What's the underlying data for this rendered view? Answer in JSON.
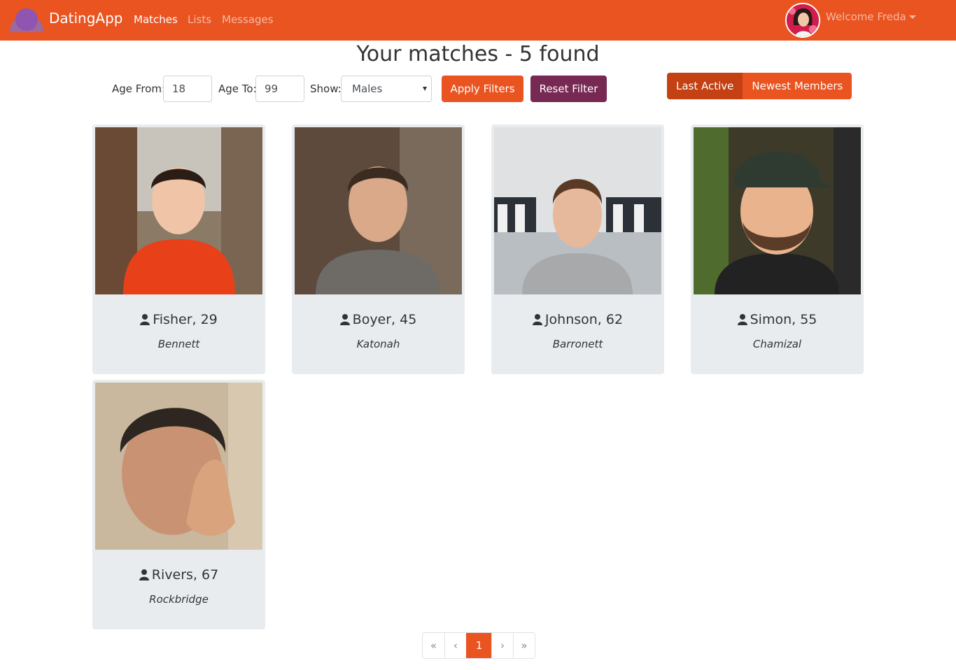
{
  "colors": {
    "primary": "#E95420",
    "secondary": "#772953",
    "card_bg": "#e9ecef"
  },
  "navbar": {
    "brand": "DatingApp",
    "links": [
      "Matches",
      "Lists",
      "Messages"
    ],
    "active_link": "Matches",
    "welcome": "Welcome Freda"
  },
  "page": {
    "title": "Your matches - 5 found"
  },
  "filters": {
    "age_from_label": "Age From:",
    "age_from_value": "18",
    "age_to_label": "Age To:",
    "age_to_value": "99",
    "show_label": "Show:",
    "show_value": "Males",
    "apply_label": "Apply Filters",
    "reset_label": "Reset Filter"
  },
  "sort": {
    "options": [
      "Last Active",
      "Newest Members"
    ],
    "active": "Last Active"
  },
  "members": [
    {
      "name": "Fisher, 29",
      "city": "Bennett"
    },
    {
      "name": "Boyer, 45",
      "city": "Katonah"
    },
    {
      "name": "Johnson, 62",
      "city": "Barronett"
    },
    {
      "name": "Simon, 55",
      "city": "Chamizal"
    },
    {
      "name": "Rivers, 67",
      "city": "Rockbridge"
    }
  ],
  "pagination": {
    "first": "«",
    "prev": "‹",
    "current": "1",
    "next": "›",
    "last": "»"
  }
}
